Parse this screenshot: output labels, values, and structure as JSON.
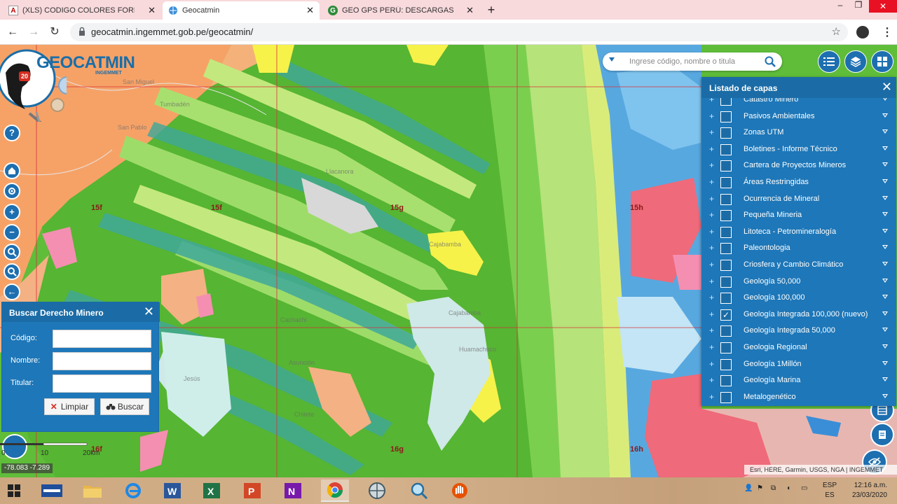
{
  "browser": {
    "tabs": [
      {
        "title": "(XLS) CODIGO COLORES FORMA",
        "favicon": "A"
      },
      {
        "title": "Geocatmin",
        "favicon": "globe"
      },
      {
        "title": "GEO GPS PERÚ: DESCARGAS GR",
        "favicon": "G"
      }
    ],
    "url": "geocatmin.ingemmet.gob.pe/geocatmin/"
  },
  "app": {
    "logo_title": "GEOCATMIN",
    "logo_subtitle": "INGEMMET",
    "logo_badge": "20",
    "search_placeholder": "Ingrese código, nombre o titula"
  },
  "map": {
    "sheet_labels": [
      "15f",
      "15f",
      "15g",
      "15h",
      "16f",
      "16g",
      "16h"
    ],
    "place_labels": [
      "San Miguel",
      "Tumbadén",
      "San Pablo",
      "Llacanora",
      "Cajabamba",
      "Cajabamba",
      "Huamachuco",
      "Cachachi",
      "Asunción",
      "Chilete",
      "Jesús"
    ],
    "scale_labels": [
      "0",
      "10",
      "20km"
    ],
    "coordinates": "-78.083 -7.289",
    "attribution": "Esri, HERE, Garmin, USGS, NGA | INGEMMET"
  },
  "layers_panel": {
    "title": "Listado de capas",
    "items": [
      {
        "name": "Catastro Minero",
        "checked": false
      },
      {
        "name": "Pasivos Ambientales",
        "checked": false
      },
      {
        "name": "Zonas UTM",
        "checked": false
      },
      {
        "name": "Boletines - Informe Técnico",
        "checked": false
      },
      {
        "name": "Cartera de Proyectos Mineros",
        "checked": false
      },
      {
        "name": "Áreas Restringidas",
        "checked": false
      },
      {
        "name": "Ocurrencia de Mineral",
        "checked": false
      },
      {
        "name": "Pequeña Mineria",
        "checked": false
      },
      {
        "name": "Litoteca - Petromineralogía",
        "checked": false
      },
      {
        "name": "Paleontologia",
        "checked": false
      },
      {
        "name": "Criosfera y Cambio Climático",
        "checked": false
      },
      {
        "name": "Geología 50,000",
        "checked": false
      },
      {
        "name": "Geología 100,000",
        "checked": false
      },
      {
        "name": "Geología Integrada 100,000 (nuevo)",
        "checked": true
      },
      {
        "name": "Geología Integrada 50,000",
        "checked": false
      },
      {
        "name": "Geologia Regional",
        "checked": false
      },
      {
        "name": "Geología 1Millón",
        "checked": false
      },
      {
        "name": "Geología Marina",
        "checked": false
      },
      {
        "name": "Metalogenético",
        "checked": false
      }
    ]
  },
  "derecho_minero": {
    "title": "Buscar Derecho Minero",
    "codigo_label": "Código:",
    "nombre_label": "Nombre:",
    "titular_label": "Titular:",
    "limpiar_label": "Limpiar",
    "buscar_label": "Buscar"
  },
  "taskbar": {
    "lang_top": "ESP",
    "lang_bottom": "ES",
    "time": "12:16 a.m.",
    "date": "23/03/2020"
  },
  "colors": {
    "panel_blue": "#1e77b8",
    "panel_header": "#1b6ca6",
    "geo_green": "#5fbd3a",
    "geo_orange": "#f6a267",
    "geo_blue": "#58a8e0"
  }
}
